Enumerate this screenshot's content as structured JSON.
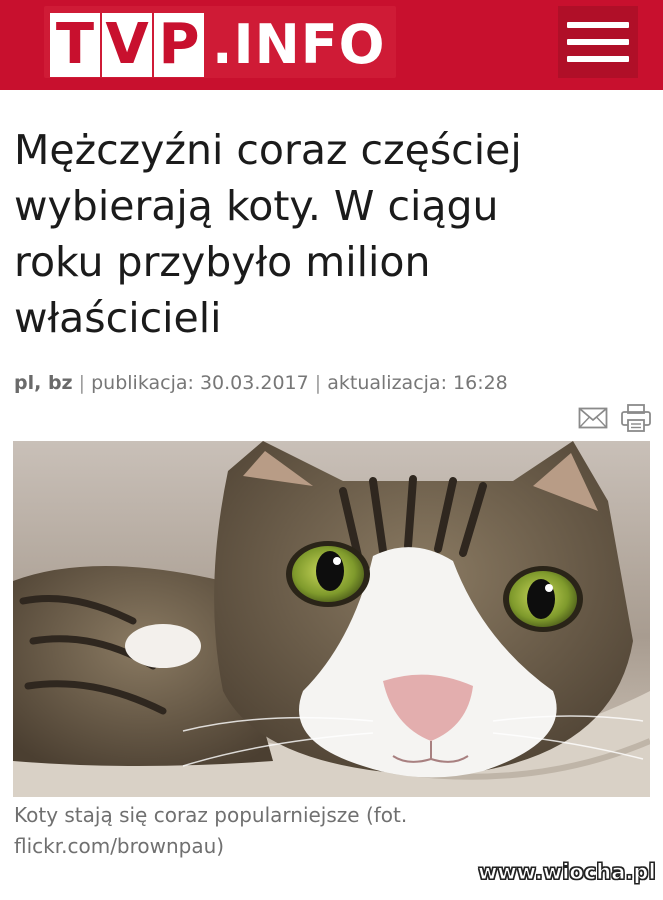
{
  "header": {
    "logo_letters": [
      "T",
      "V",
      "P"
    ],
    "logo_suffix": ".INFO",
    "brand_color": "#c8102e",
    "menu_icon": "hamburger-menu-icon"
  },
  "article": {
    "title_lines": [
      "Mężczyźni coraz częściej",
      "wybierają koty. W ciągu",
      "roku przybyło milion",
      "właścicieli"
    ],
    "authors": "pl, bz",
    "separator": "|",
    "published": "publikacja: 30.03.2017",
    "updated": "aktualizacja: 16:28",
    "actions": {
      "mail_icon": "envelope-icon",
      "print_icon": "printer-icon"
    },
    "photo_subject": "cat",
    "caption_lines": [
      "Koty stają się coraz popularniejsze (fot.",
      "flickr.com/brownpau)"
    ]
  },
  "watermark": "www.wiocha.pl"
}
